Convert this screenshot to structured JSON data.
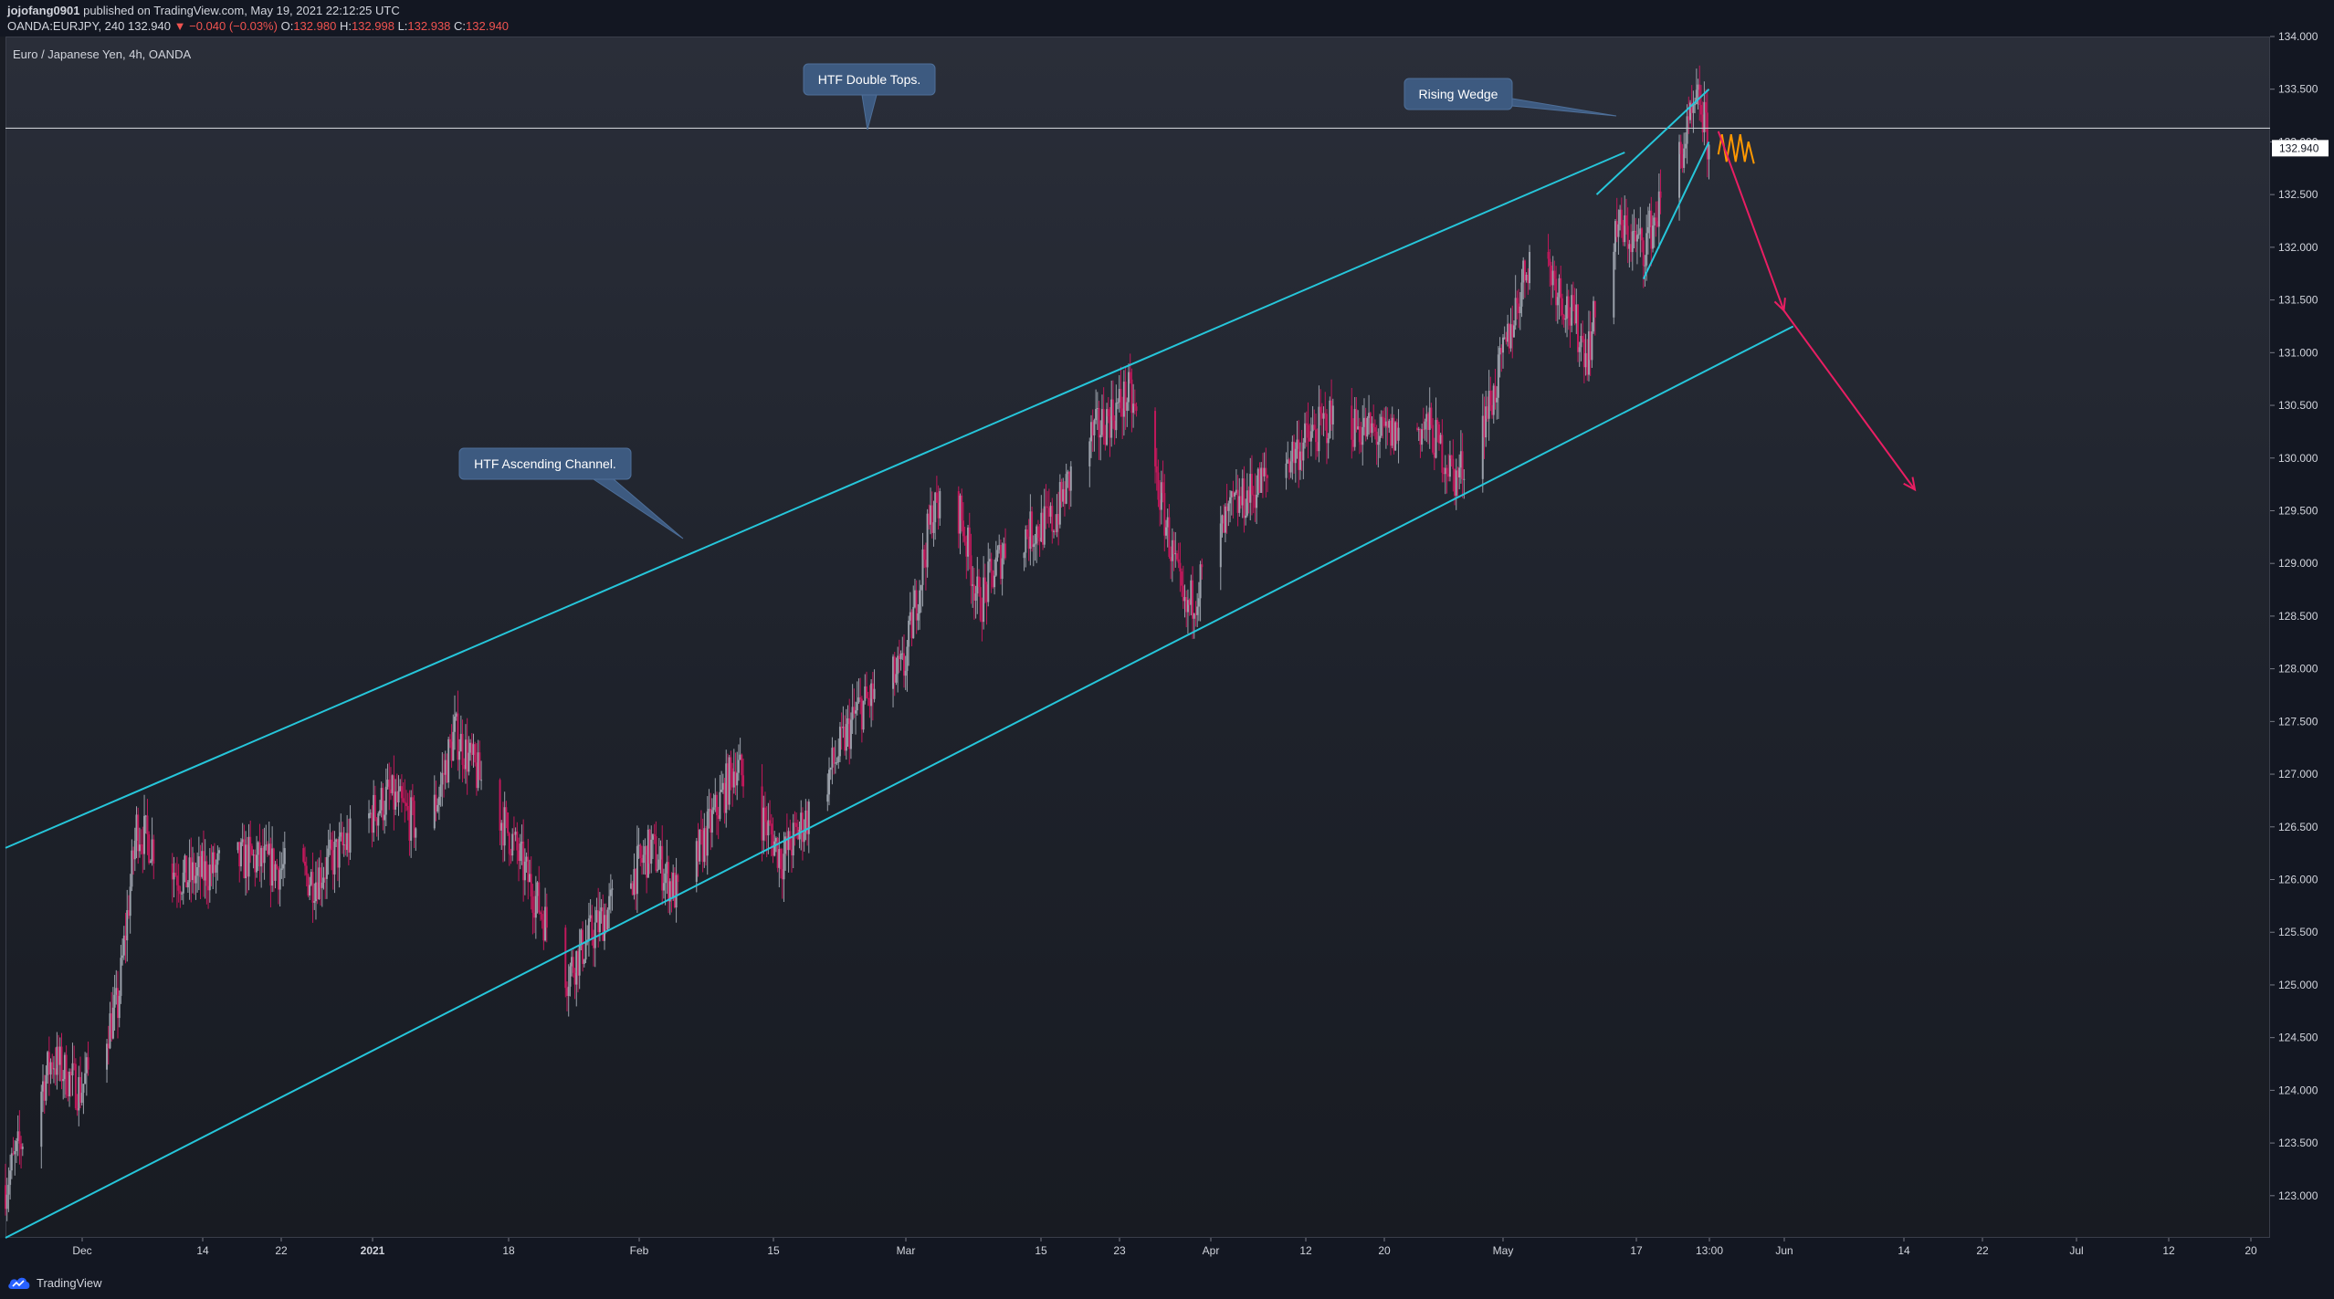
{
  "header": {
    "author": "jojofang0901",
    "published_text": "published on TradingView.com, May 19, 2021 22:12:25 UTC",
    "symbol": "OANDA:EURJPY, 240",
    "last": "132.940",
    "change": "▼ −0.040 (−0.03%)",
    "o_label": "O:",
    "o_value": "132.980",
    "h_label": "H:",
    "h_value": "132.998",
    "l_label": "L:",
    "l_value": "132.938",
    "c_label": "C:",
    "c_value": "132.940"
  },
  "chart_title": "Euro / Japanese Yen, 4h, OANDA",
  "footer": {
    "brand": "TradingView",
    "logo_icon": "tradingview-cloud-icon"
  },
  "colors": {
    "channel": "#26c6da",
    "projection": "#e91e63",
    "sketch": "#ff9800",
    "candle_up": "#9aa0aa",
    "candle_down": "#c2185b",
    "callout_bg": "#3d5a80",
    "price_tag_bg": "#ffffff"
  },
  "chart_data": {
    "type": "candlestick",
    "instrument": "EUR/JPY",
    "timeframe": "4h",
    "y_axis": {
      "ticks": [
        "134.000",
        "133.500",
        "133.000",
        "132.500",
        "132.000",
        "131.500",
        "131.000",
        "130.500",
        "130.000",
        "129.500",
        "129.000",
        "128.500",
        "128.000",
        "127.500",
        "127.000",
        "126.500",
        "126.000",
        "125.500",
        "125.000",
        "124.500",
        "124.000",
        "123.500",
        "123.000"
      ],
      "ylim": [
        122.6,
        134.0
      ]
    },
    "x_axis": {
      "ticks": [
        "Dec",
        "14",
        "22",
        "2021",
        "18",
        "Feb",
        "15",
        "Mar",
        "15",
        "23",
        "Apr",
        "12",
        "20",
        "May",
        "17",
        "13:00",
        "Jun",
        "14",
        "22",
        "Jul",
        "12",
        "20"
      ]
    },
    "last_price": "132.940",
    "horizontal_level": 133.13,
    "price_path": [
      {
        "date": "2020-11-19",
        "price": 123.1
      },
      {
        "date": "2020-11-24",
        "price": 124.3
      },
      {
        "date": "2020-11-27",
        "price": 124.0
      },
      {
        "date": "2020-12-01",
        "price": 124.8
      },
      {
        "date": "2020-12-03",
        "price": 126.5
      },
      {
        "date": "2020-12-08",
        "price": 126.0
      },
      {
        "date": "2020-12-15",
        "price": 126.2
      },
      {
        "date": "2020-12-22",
        "price": 126.0
      },
      {
        "date": "2020-12-30",
        "price": 126.8
      },
      {
        "date": "2021-01-03",
        "price": 126.4
      },
      {
        "date": "2021-01-06",
        "price": 127.4
      },
      {
        "date": "2021-01-12",
        "price": 126.4
      },
      {
        "date": "2021-01-18",
        "price": 125.1
      },
      {
        "date": "2021-01-20",
        "price": 125.4
      },
      {
        "date": "2021-01-27",
        "price": 126.3
      },
      {
        "date": "2021-01-30",
        "price": 125.8
      },
      {
        "date": "2021-02-05",
        "price": 127.1
      },
      {
        "date": "2021-02-10",
        "price": 126.2
      },
      {
        "date": "2021-02-14",
        "price": 126.8
      },
      {
        "date": "2021-02-18",
        "price": 127.6
      },
      {
        "date": "2021-02-23",
        "price": 128.0
      },
      {
        "date": "2021-02-26",
        "price": 129.5
      },
      {
        "date": "2021-03-01",
        "price": 129.5
      },
      {
        "date": "2021-03-03",
        "price": 128.6
      },
      {
        "date": "2021-03-06",
        "price": 129.2
      },
      {
        "date": "2021-03-11",
        "price": 129.4
      },
      {
        "date": "2021-03-14",
        "price": 130.1
      },
      {
        "date": "2021-03-19",
        "price": 130.6
      },
      {
        "date": "2021-03-22",
        "price": 129.8
      },
      {
        "date": "2021-03-25",
        "price": 128.5
      },
      {
        "date": "2021-03-30",
        "price": 129.5
      },
      {
        "date": "2021-04-05",
        "price": 130.0
      },
      {
        "date": "2021-04-10",
        "price": 130.4
      },
      {
        "date": "2021-04-15",
        "price": 130.2
      },
      {
        "date": "2021-04-20",
        "price": 130.3
      },
      {
        "date": "2021-04-23",
        "price": 129.8
      },
      {
        "date": "2021-04-27",
        "price": 130.6
      },
      {
        "date": "2021-05-01",
        "price": 132.0
      },
      {
        "date": "2021-05-03",
        "price": 131.8
      },
      {
        "date": "2021-05-07",
        "price": 131.0
      },
      {
        "date": "2021-05-10",
        "price": 132.2
      },
      {
        "date": "2021-05-13",
        "price": 132.0
      },
      {
        "date": "2021-05-17",
        "price": 132.9
      },
      {
        "date": "2021-05-19",
        "price": 133.4
      },
      {
        "date": "2021-05-20",
        "price": 132.94
      }
    ],
    "annotations": [
      {
        "text": "HTF Ascending Channel."
      },
      {
        "text": "HTF Double Tops."
      },
      {
        "text": "Rising Wedge"
      }
    ],
    "channel": {
      "upper": [
        {
          "date": "2020-11-19",
          "price": 126.3
        },
        {
          "date": "2021-05-11",
          "price": 132.9
        }
      ],
      "lower": [
        {
          "date": "2020-11-19",
          "price": 122.6
        },
        {
          "date": "2021-05-29",
          "price": 131.25
        }
      ]
    },
    "wedge": {
      "upper": [
        {
          "date": "2021-05-08",
          "price": 132.5
        },
        {
          "date": "2021-05-20",
          "price": 133.5
        }
      ],
      "lower": [
        {
          "date": "2021-05-13",
          "price": 131.7
        },
        {
          "date": "2021-05-20",
          "price": 133.0
        }
      ]
    },
    "projection": [
      {
        "date": "2021-05-21",
        "price": 133.1
      },
      {
        "date": "2021-05-28",
        "price": 131.4
      },
      {
        "date": "2021-06-11",
        "price": 129.7
      }
    ],
    "grid": false,
    "legend": "none"
  }
}
